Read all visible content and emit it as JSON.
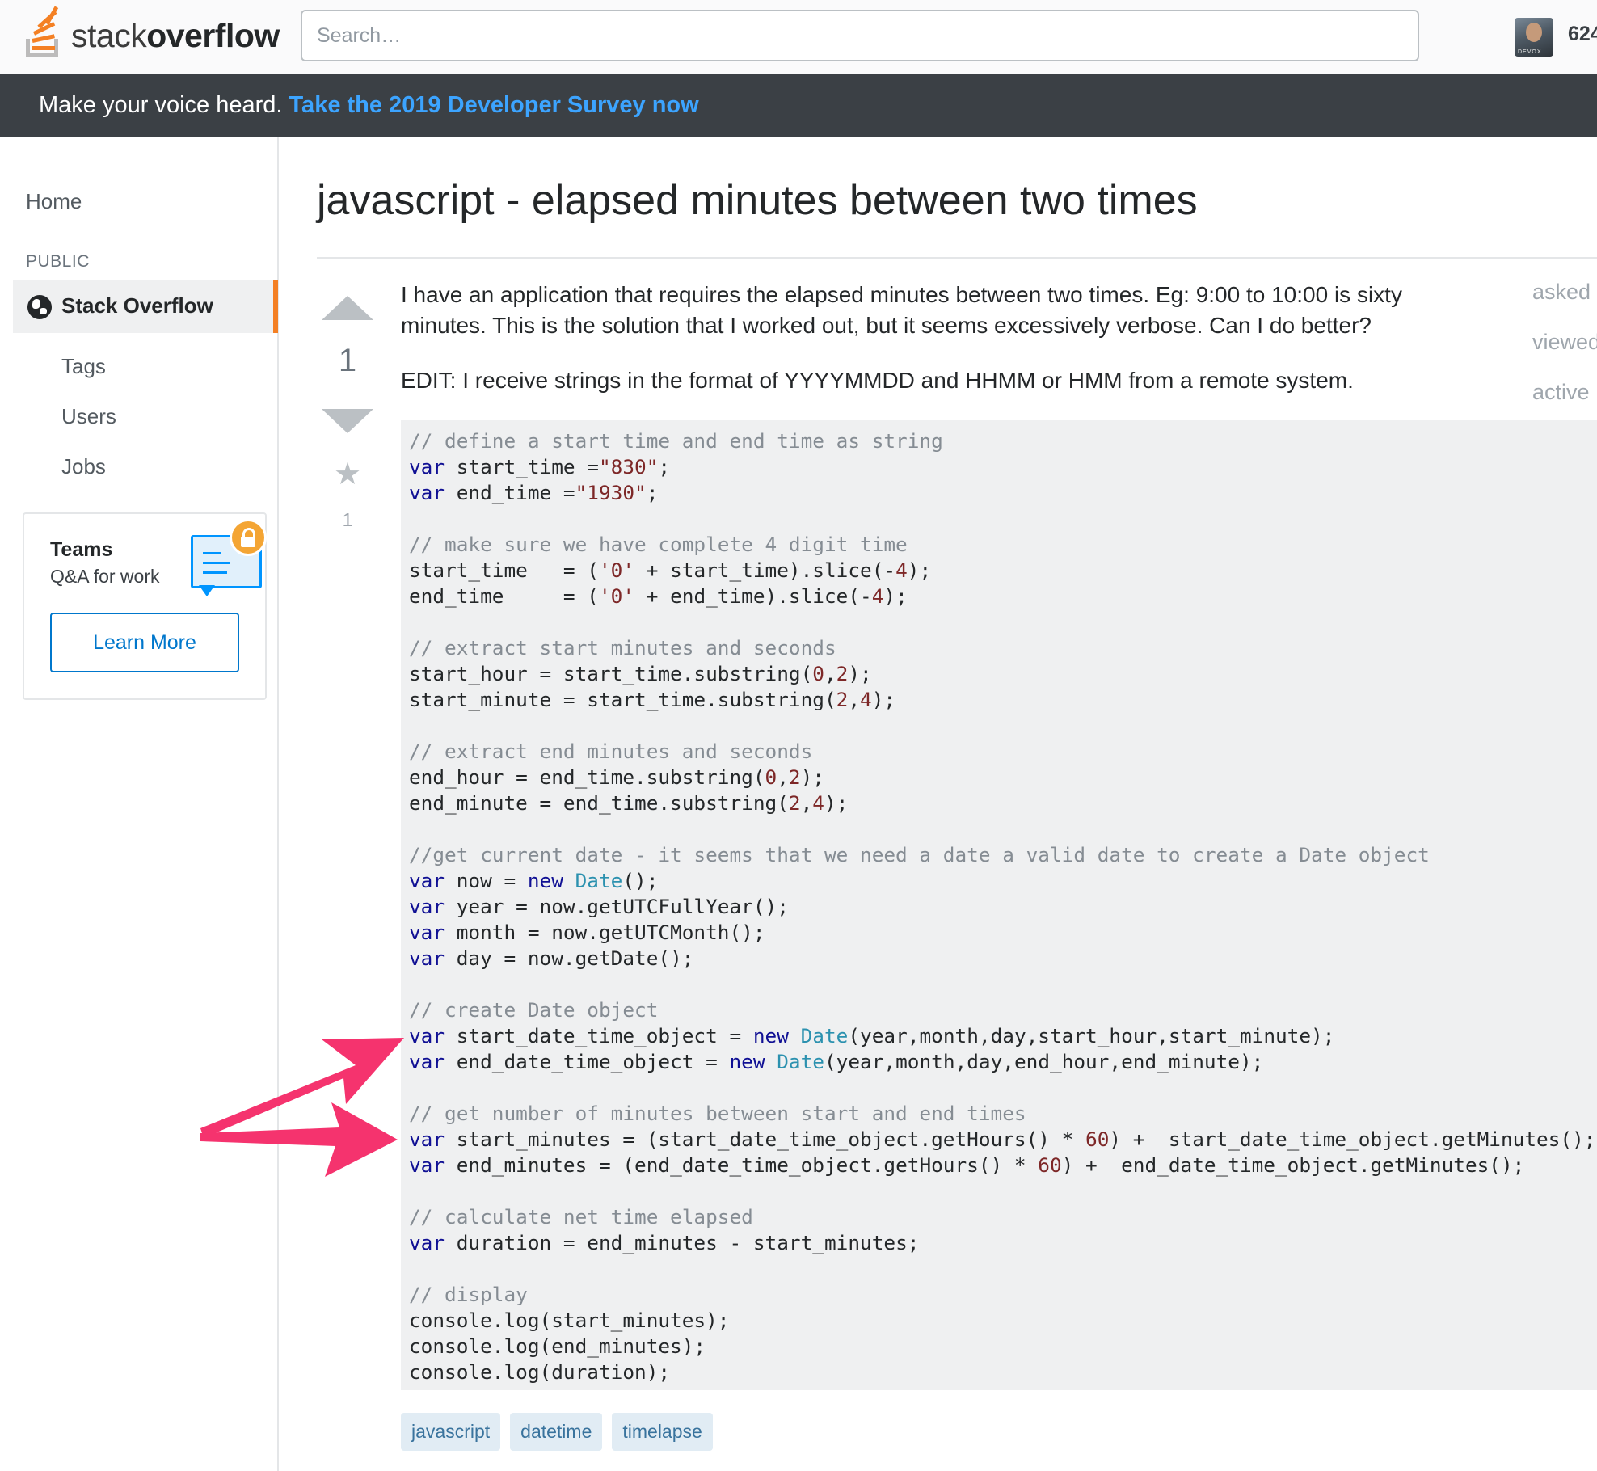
{
  "header": {
    "logo_text_light": "stack",
    "logo_text_bold": "overflow",
    "search_placeholder": "Search…",
    "reputation": "624",
    "avatar_caption": "DEVOX"
  },
  "banner": {
    "text": "Make your voice heard.",
    "link": "Take the 2019 Developer Survey now"
  },
  "sidebar": {
    "home": "Home",
    "public_heading": "PUBLIC",
    "stack_overflow": "Stack Overflow",
    "items": [
      "Tags",
      "Users",
      "Jobs"
    ],
    "teams": {
      "title": "Teams",
      "subtitle": "Q&A for work",
      "button": "Learn More"
    }
  },
  "question": {
    "title": "javascript - elapsed minutes between two times",
    "votes": "1",
    "favorites": "1",
    "body": "I have an application that requires the elapsed minutes between two times. Eg: 9:00 to 10:00 is sixty minutes. This is the solution that I worked out, but it seems excessively verbose. Can I do better?",
    "edit": "EDIT: I receive strings in the format of YYYYMMDD and HHMM or HMM from a remote system.",
    "meta": [
      "asked",
      "viewed",
      "active"
    ],
    "code_lines": [
      [
        [
          "c",
          "// define a start time and end time as string"
        ]
      ],
      [
        [
          "k",
          "var"
        ],
        [
          "p",
          " start_time ="
        ],
        [
          "s",
          "\"830\""
        ],
        [
          "p",
          ";"
        ]
      ],
      [
        [
          "k",
          "var"
        ],
        [
          "p",
          " end_time ="
        ],
        [
          "s",
          "\"1930\""
        ],
        [
          "p",
          ";"
        ]
      ],
      [],
      [
        [
          "c",
          "// make sure we have complete 4 digit time"
        ]
      ],
      [
        [
          "p",
          "start_time   = ("
        ],
        [
          "s",
          "'0'"
        ],
        [
          "p",
          " + start_time).slice(-"
        ],
        [
          "n",
          "4"
        ],
        [
          "p",
          ");"
        ]
      ],
      [
        [
          "p",
          "end_time     = ("
        ],
        [
          "s",
          "'0'"
        ],
        [
          "p",
          " + end_time).slice(-"
        ],
        [
          "n",
          "4"
        ],
        [
          "p",
          ");"
        ]
      ],
      [],
      [
        [
          "c",
          "// extract start minutes and seconds"
        ]
      ],
      [
        [
          "p",
          "start_hour = start_time.substring("
        ],
        [
          "n",
          "0"
        ],
        [
          "p",
          ","
        ],
        [
          "n",
          "2"
        ],
        [
          "p",
          ");"
        ]
      ],
      [
        [
          "p",
          "start_minute = start_time.substring("
        ],
        [
          "n",
          "2"
        ],
        [
          "p",
          ","
        ],
        [
          "n",
          "4"
        ],
        [
          "p",
          ");"
        ]
      ],
      [],
      [
        [
          "c",
          "// extract end minutes and seconds"
        ]
      ],
      [
        [
          "p",
          "end_hour = end_time.substring("
        ],
        [
          "n",
          "0"
        ],
        [
          "p",
          ","
        ],
        [
          "n",
          "2"
        ],
        [
          "p",
          ");"
        ]
      ],
      [
        [
          "p",
          "end_minute = end_time.substring("
        ],
        [
          "n",
          "2"
        ],
        [
          "p",
          ","
        ],
        [
          "n",
          "4"
        ],
        [
          "p",
          ");"
        ]
      ],
      [],
      [
        [
          "c",
          "//get current date - it seems that we need a date a valid date to create a Date object"
        ]
      ],
      [
        [
          "k",
          "var"
        ],
        [
          "p",
          " now = "
        ],
        [
          "k",
          "new"
        ],
        [
          "p",
          " "
        ],
        [
          "t",
          "Date"
        ],
        [
          "p",
          "();"
        ]
      ],
      [
        [
          "k",
          "var"
        ],
        [
          "p",
          " year = now.getUTCFullYear();"
        ]
      ],
      [
        [
          "k",
          "var"
        ],
        [
          "p",
          " month = now.getUTCMonth();"
        ]
      ],
      [
        [
          "k",
          "var"
        ],
        [
          "p",
          " day = now.getDate();"
        ]
      ],
      [],
      [
        [
          "c",
          "// create Date object"
        ]
      ],
      [
        [
          "k",
          "var"
        ],
        [
          "p",
          " start_date_time_object = "
        ],
        [
          "k",
          "new"
        ],
        [
          "p",
          " "
        ],
        [
          "t",
          "Date"
        ],
        [
          "p",
          "(year,month,day,start_hour,start_minute);"
        ]
      ],
      [
        [
          "k",
          "var"
        ],
        [
          "p",
          " end_date_time_object = "
        ],
        [
          "k",
          "new"
        ],
        [
          "p",
          " "
        ],
        [
          "t",
          "Date"
        ],
        [
          "p",
          "(year,month,day,end_hour,end_minute);"
        ]
      ],
      [],
      [
        [
          "c",
          "// get number of minutes between start and end times"
        ]
      ],
      [
        [
          "k",
          "var"
        ],
        [
          "p",
          " start_minutes = (start_date_time_object.getHours() * "
        ],
        [
          "n",
          "60"
        ],
        [
          "p",
          ") +  start_date_time_object.getMinutes();"
        ]
      ],
      [
        [
          "k",
          "var"
        ],
        [
          "p",
          " end_minutes = (end_date_time_object.getHours() * "
        ],
        [
          "n",
          "60"
        ],
        [
          "p",
          ") +  end_date_time_object.getMinutes();"
        ]
      ],
      [],
      [
        [
          "c",
          "// calculate net time elapsed"
        ]
      ],
      [
        [
          "k",
          "var"
        ],
        [
          "p",
          " duration = end_minutes - start_minutes;"
        ]
      ],
      [],
      [
        [
          "c",
          "// display"
        ]
      ],
      [
        [
          "p",
          "console.log(start_minutes);"
        ]
      ],
      [
        [
          "p",
          "console.log(end_minutes);"
        ]
      ],
      [
        [
          "p",
          "console.log(duration);"
        ]
      ]
    ],
    "tags": [
      "javascript",
      "datetime",
      "timelapse"
    ]
  },
  "colors": {
    "accent_orange": "#f48024",
    "link_blue": "#0077cc",
    "banner_bg": "#3b4045",
    "banner_link": "#3ca4ff",
    "annotation_arrow": "#f5336e",
    "tag_bg": "#e1ecf4"
  }
}
